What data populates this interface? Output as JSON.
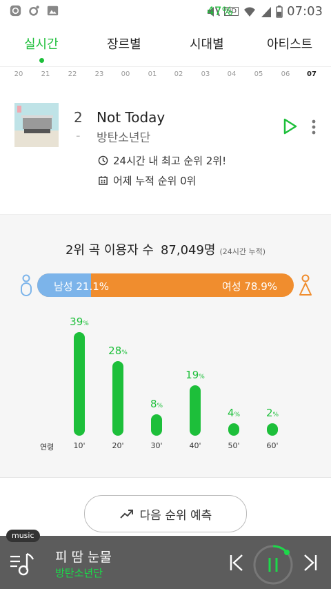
{
  "statusbar": {
    "battery": "47%",
    "time": "07:03",
    "net": "HD",
    "signal": "6"
  },
  "tabs": [
    "실시간",
    "장르별",
    "시대별",
    "아티스트"
  ],
  "hours": [
    "20",
    "21",
    "22",
    "23",
    "00",
    "01",
    "02",
    "03",
    "04",
    "05",
    "06",
    "07"
  ],
  "song": {
    "rank": "2",
    "rank_change": "-",
    "title": "Not Today",
    "artist": "방탄소년단",
    "best_rank": "24시간 내 최고 순위 2위!",
    "cumulative": "어제 누적 순위 0위"
  },
  "stats": {
    "users_label": "2위 곡 이용자 수",
    "users_count": "87,049명",
    "users_note": "(24시간 누적)",
    "male_label": "남성 21.1%",
    "female_label": "여성 78.9%",
    "male_share": 21.1
  },
  "chart_data": {
    "type": "bar",
    "categories": [
      "10'",
      "20'",
      "30'",
      "40'",
      "50'",
      "60'"
    ],
    "values": [
      39,
      28,
      8,
      19,
      4,
      2
    ],
    "value_labels": [
      "39",
      "28",
      "8",
      "19",
      "4",
      "2"
    ],
    "unit": "%",
    "xlabel": "연령",
    "ylim": [
      0,
      39
    ]
  },
  "predict_button": "다음 순위 예측",
  "player": {
    "tag": "music",
    "title": "피 땀 눈물",
    "artist": "방탄소년단"
  },
  "colors": {
    "accent": "#1dbf3a",
    "male": "#7cb4ea",
    "female": "#f08d2e"
  }
}
